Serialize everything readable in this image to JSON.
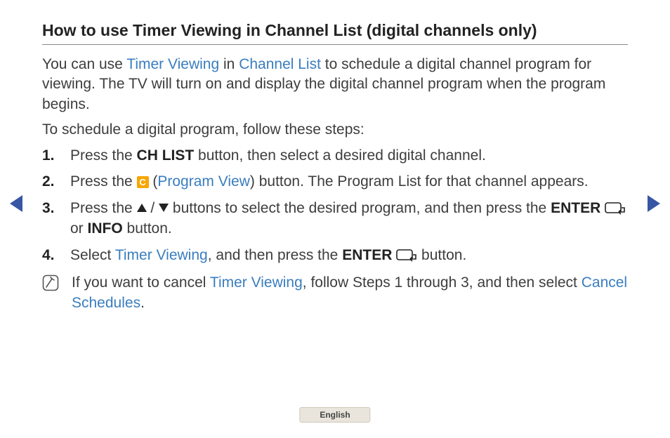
{
  "title": "How to use Timer Viewing in Channel List (digital channels only)",
  "intro": {
    "pre": "You can use ",
    "tv": "Timer Viewing",
    "mid1": " in ",
    "cl": "Channel List",
    "post": " to schedule a digital channel program for viewing. The TV will turn on and display the digital channel program when the program begins."
  },
  "stepsLabel": "To schedule a digital program, follow these steps:",
  "nums": {
    "n1": "1.",
    "n2": "2.",
    "n3": "3.",
    "n4": "4."
  },
  "step1": {
    "pre": "Press the ",
    "chlist": "CH LIST",
    "post": " button, then select a desired digital channel."
  },
  "step2": {
    "pre": "Press the ",
    "c": "C",
    "lp": " (",
    "pv": "Program View",
    "rp": ")",
    "post": " button. The Program List for that channel appears."
  },
  "step3": {
    "pre": "Press the ",
    "slash": " / ",
    "mid": " buttons to select the desired program, and then press the ",
    "enter": "ENTER",
    "or": " or ",
    "info": "INFO",
    "post": " button."
  },
  "step4": {
    "pre": "Select ",
    "tv": "Timer Viewing",
    "mid": ", and then press the ",
    "enter": "ENTER",
    "post": " button."
  },
  "note": {
    "pre": "If you want to cancel ",
    "tv": "Timer Viewing",
    "mid": ", follow Steps 1 through 3, and then select ",
    "cs": "Cancel Schedules",
    "post": "."
  },
  "lang": "English"
}
